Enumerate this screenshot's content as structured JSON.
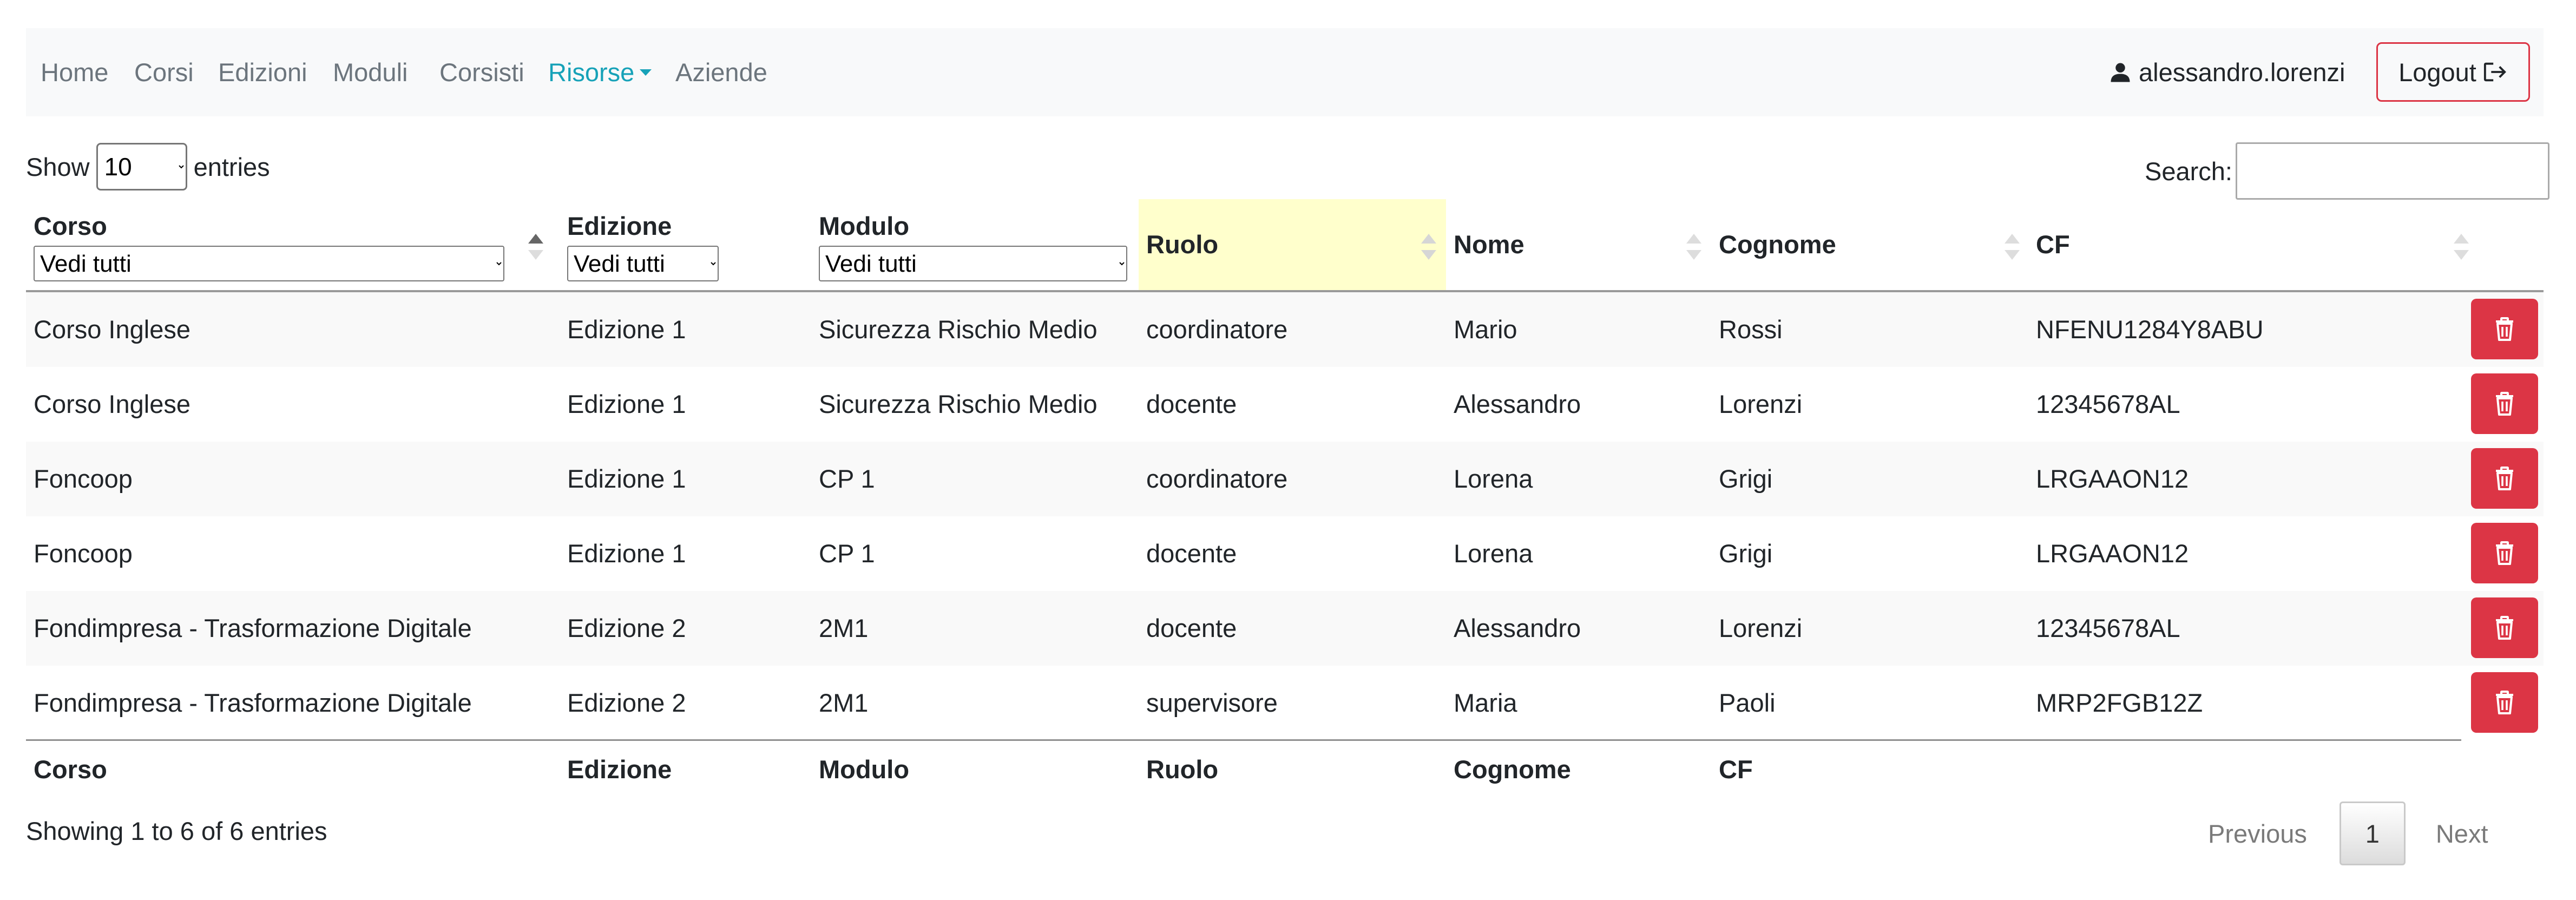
{
  "nav": {
    "items": [
      "Home",
      "Corsi",
      "Edizioni",
      "Moduli",
      "Corsisti"
    ],
    "active_dropdown": "Risorse",
    "last_item": "Aziende",
    "active_color": "#17a2b8",
    "username": "alessandro.lorenzi",
    "logout_label": "Logout"
  },
  "controls": {
    "show_label": "Show",
    "entries_value": "10",
    "entries_label": "entries",
    "search_label": "Search:",
    "search_value": ""
  },
  "table": {
    "headers": {
      "corso": "Corso",
      "edizione": "Edizione",
      "modulo": "Modulo",
      "ruolo": "Ruolo",
      "nome": "Nome",
      "cognome": "Cognome",
      "cf": "CF"
    },
    "filter_all": "Vedi tutti",
    "rows": [
      {
        "corso": "Corso Inglese",
        "edizione": "Edizione 1",
        "modulo": "Sicurezza Rischio Medio",
        "ruolo": "coordinatore",
        "nome": "Mario",
        "cognome": "Rossi",
        "cf": "NFENU1284Y8ABU"
      },
      {
        "corso": "Corso Inglese",
        "edizione": "Edizione 1",
        "modulo": "Sicurezza Rischio Medio",
        "ruolo": "docente",
        "nome": "Alessandro",
        "cognome": "Lorenzi",
        "cf": "12345678AL"
      },
      {
        "corso": "Foncoop",
        "edizione": "Edizione 1",
        "modulo": "CP 1",
        "ruolo": "coordinatore",
        "nome": "Lorena",
        "cognome": "Grigi",
        "cf": "LRGAAON12"
      },
      {
        "corso": "Foncoop",
        "edizione": "Edizione 1",
        "modulo": "CP 1",
        "ruolo": "docente",
        "nome": "Lorena",
        "cognome": "Grigi",
        "cf": "LRGAAON12"
      },
      {
        "corso": "Fondimpresa - Trasformazione Digitale",
        "edizione": "Edizione 2",
        "modulo": "2M1",
        "ruolo": "docente",
        "nome": "Alessandro",
        "cognome": "Lorenzi",
        "cf": "12345678AL"
      },
      {
        "corso": "Fondimpresa - Trasformazione Digitale",
        "edizione": "Edizione 2",
        "modulo": "2M1",
        "ruolo": "supervisore",
        "nome": "Maria",
        "cognome": "Paoli",
        "cf": "MRP2FGB12Z"
      }
    ],
    "footer": [
      "Corso",
      "Edizione",
      "Modulo",
      "Ruolo",
      "Cognome",
      "CF"
    ],
    "delete_color": "#dc3545",
    "sorted_column_color": "#ffffcc"
  },
  "info": "Showing 1 to 6 of 6 entries",
  "pagination": {
    "previous": "Previous",
    "current": "1",
    "next": "Next"
  }
}
